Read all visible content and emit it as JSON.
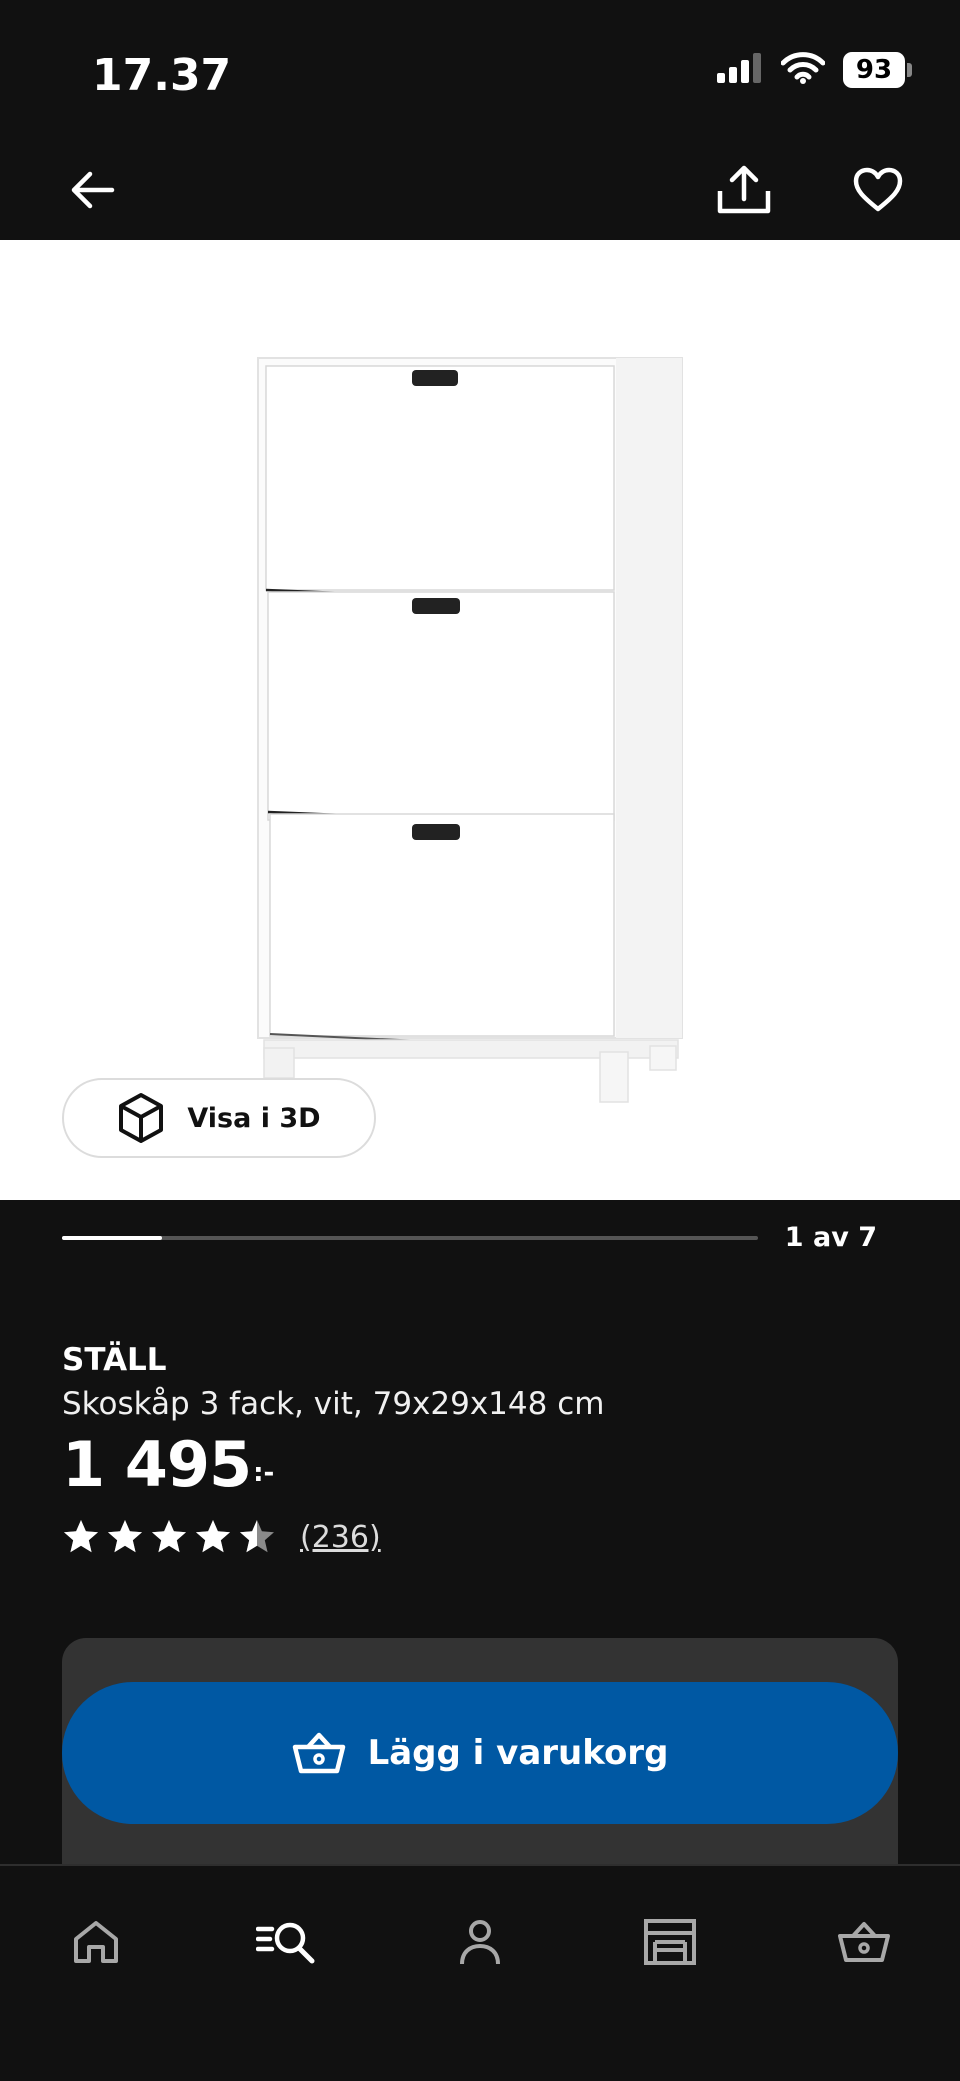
{
  "status_bar": {
    "time": "17.37",
    "battery": "93",
    "icons": [
      "signal-icon",
      "wifi-icon",
      "battery-icon"
    ]
  },
  "top_nav": {
    "icons": [
      "back-arrow-icon",
      "share-icon",
      "heart-icon"
    ]
  },
  "gallery": {
    "view_3d_label": "Visa i 3D",
    "counter": "1 av 7",
    "progress_fraction": 0.143
  },
  "product": {
    "name": "STÄLL",
    "description": "Skoskåp 3 fack, vit, 79x29x148 cm",
    "price": "1 495",
    "price_suffix": ":-",
    "rating": 4.5,
    "review_count": "(236)"
  },
  "cart": {
    "button_label": "Lägg i varukorg"
  },
  "tab_bar": {
    "tabs": [
      "home-icon",
      "search-icon",
      "profile-icon",
      "store-icon",
      "cart-icon"
    ]
  },
  "colors": {
    "background": "#111111",
    "primary_button": "#0058a3",
    "panel": "#333333"
  }
}
